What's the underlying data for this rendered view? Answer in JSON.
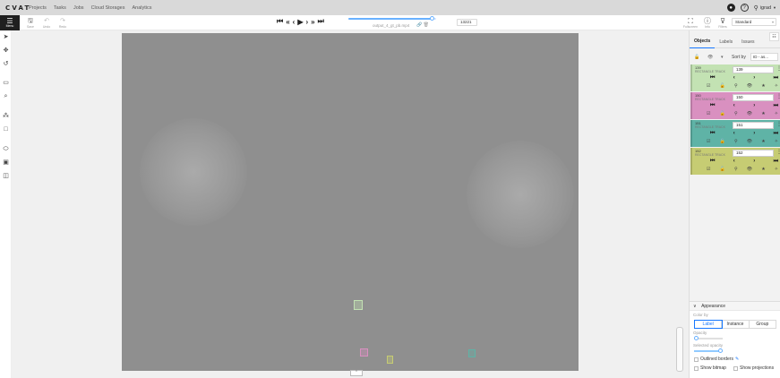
{
  "topnav": {
    "logo": "CVAT",
    "links": [
      "Projects",
      "Tasks",
      "Jobs",
      "Cloud Storages",
      "Analytics"
    ],
    "user": "igrad",
    "icons": [
      "github-icon",
      "help-icon",
      "user-icon",
      "caret-down-icon"
    ]
  },
  "toolbar": {
    "menu_label": "Menu",
    "save_label": "Save",
    "undo_label": "Undo",
    "redo_label": "Redo",
    "filename": "output_4_gt_pb.mp4",
    "frame_number": "13221",
    "frame_progress": 0.96,
    "fullscreen_label": "Fullscreen",
    "info_label": "Info",
    "filters_label": "Filters",
    "workspace": "Standard"
  },
  "left_tools": [
    "cursor-icon",
    "move-icon",
    "rotate-icon",
    "rectangle-icon",
    "zoom-icon",
    "ai-tools-icon",
    "opencv-icon",
    "polygon-icon",
    "track-icon",
    "merge-icon"
  ],
  "sidebar": {
    "tabs": [
      "Objects",
      "Labels",
      "Issues"
    ],
    "sort_label": "Sort by",
    "sort_value": "ID - as...",
    "objects": [
      {
        "id": "139",
        "type": "RECTANGLE TRACK",
        "label": "139",
        "color": "#c3e2b3"
      },
      {
        "id": "150",
        "type": "RECTANGLE TRACK",
        "label": "150",
        "color": "#d990c0"
      },
      {
        "id": "151",
        "type": "RECTANGLE TRACK",
        "label": "151",
        "color": "#5fb3a6"
      },
      {
        "id": "152",
        "type": "RECTANGLE TRACK",
        "label": "152",
        "color": "#c6cc73"
      }
    ]
  },
  "appearance": {
    "title": "Appearance",
    "color_by_label": "Color by",
    "color_by_options": [
      "Label",
      "Instance",
      "Group"
    ],
    "color_by_selected": "Label",
    "opacity_label": "Opacity",
    "opacity_value": 0,
    "selected_opacity_label": "Selected opacity",
    "selected_opacity_value": 0.9,
    "outlined_borders": "Outlined borders",
    "show_bitmap": "Show bitmap",
    "show_projections": "Show projections"
  }
}
